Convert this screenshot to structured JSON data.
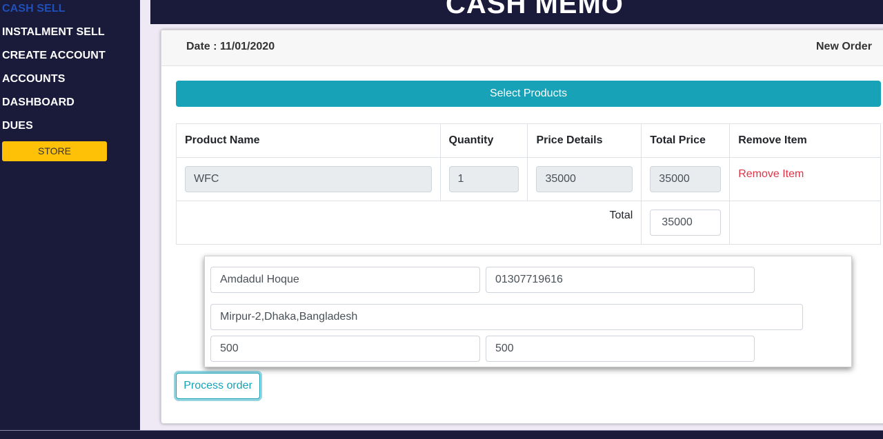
{
  "sidebar": {
    "items": [
      {
        "label": "CASH SELL",
        "active": true
      },
      {
        "label": "INSTALMENT SELL"
      },
      {
        "label": "CREATE ACCOUNT"
      },
      {
        "label": "ACCOUNTS"
      },
      {
        "label": "DASHBOARD"
      },
      {
        "label": "DUES"
      }
    ],
    "store_label": "STORE"
  },
  "header": {
    "title": "CASH MEMO"
  },
  "card": {
    "date": "Date : 11/01/2020",
    "new_order": "New Order",
    "select_products": "Select Products",
    "table": {
      "columns": [
        "Product Name",
        "Quantity",
        "Price Details",
        "Total Price",
        "Remove Item"
      ],
      "rows": [
        {
          "product": "WFC",
          "quantity": "1",
          "price": "35000",
          "total": "35000",
          "remove": "Remove Item"
        }
      ],
      "total_label": "Total",
      "total_value": "35000"
    },
    "customer": {
      "name": "Amdadul Hoque",
      "phone": "01307719616",
      "address": "Mirpur-2,Dhaka,Bangladesh",
      "field_a": "500",
      "field_b": "500"
    },
    "process_label": "Process order"
  },
  "colors": {
    "sidebar_bg": "#1a1a3a",
    "active_nav": "#1f4fb8",
    "store_btn": "#ffc107",
    "primary_info": "#17a2b8",
    "danger": "#dc3545"
  }
}
